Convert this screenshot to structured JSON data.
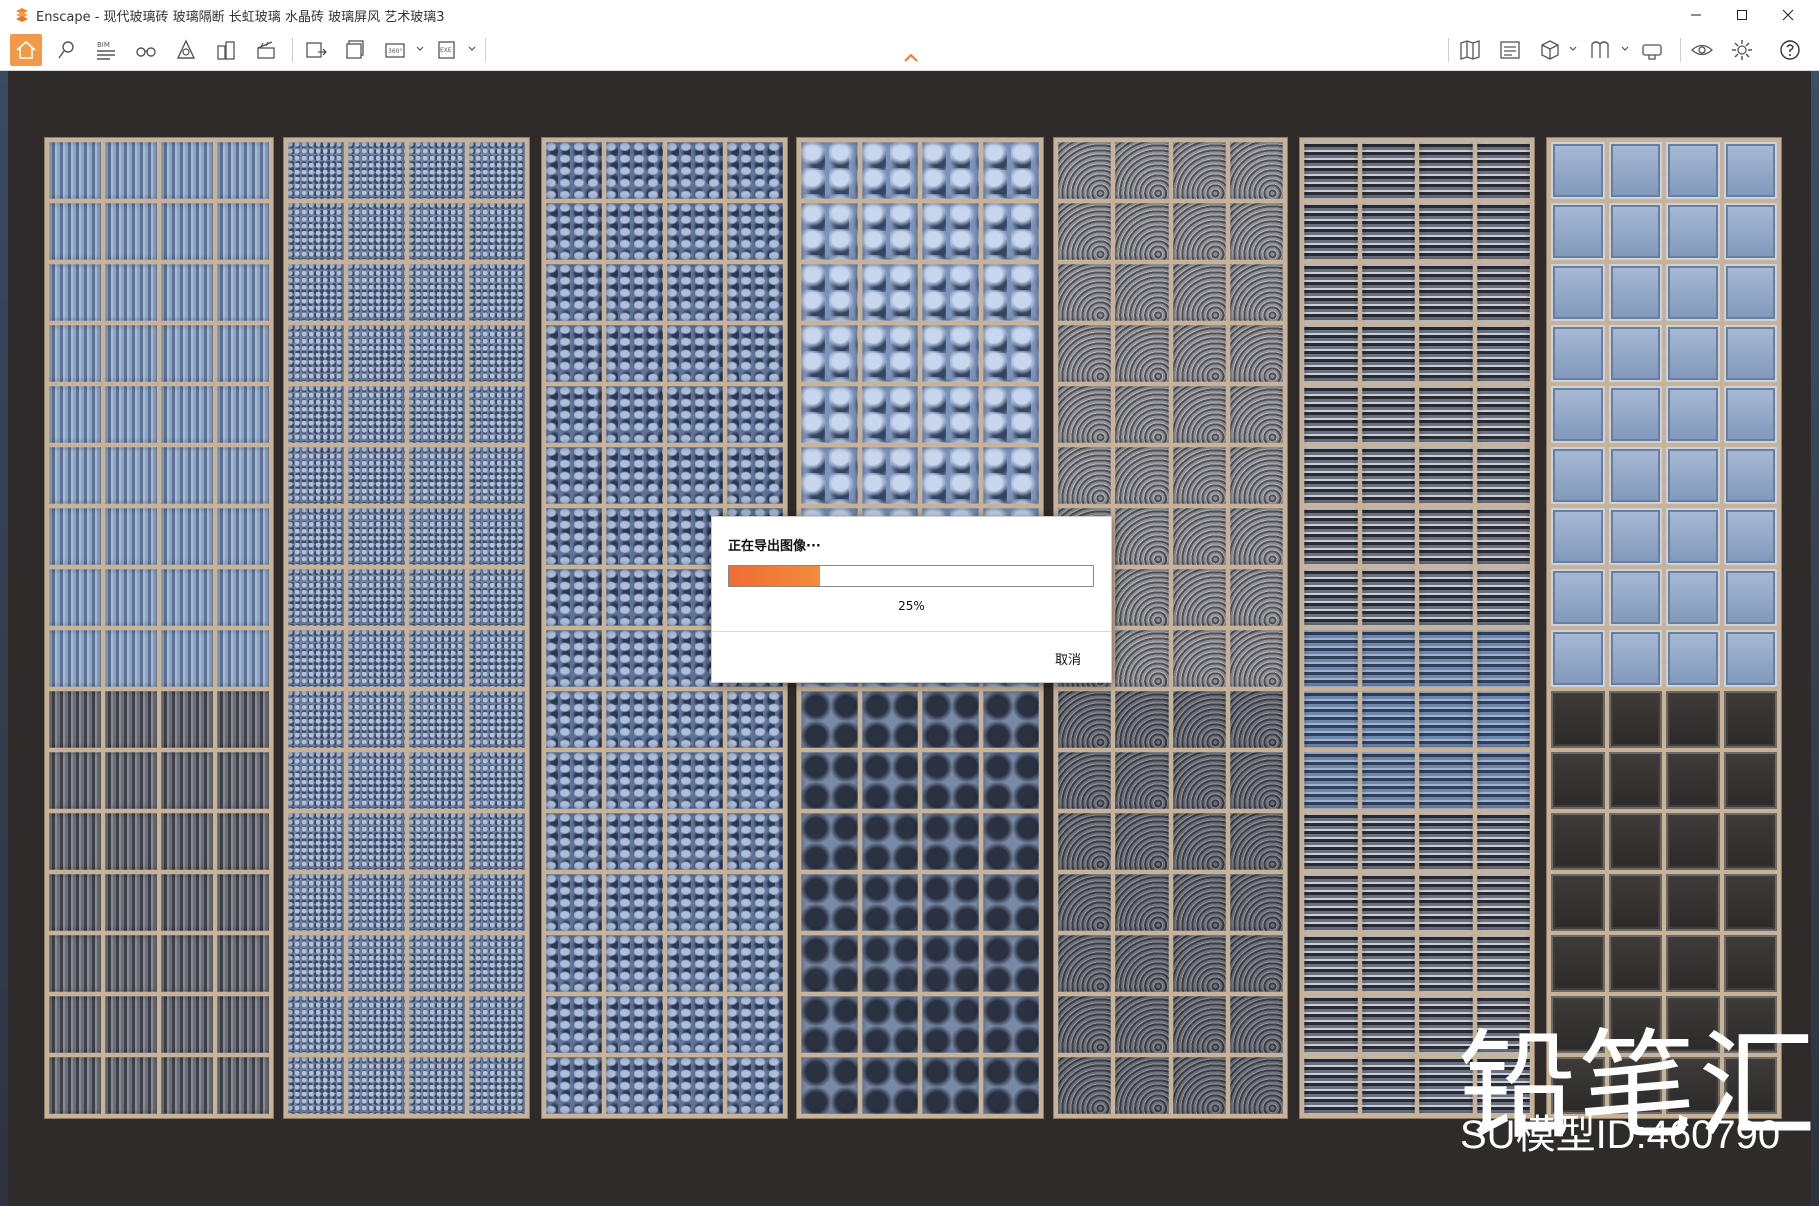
{
  "window": {
    "title": "Enscape - 现代玻璃砖 玻璃隔断 长虹玻璃 水晶砖 玻璃屏风 艺术玻璃3",
    "minimize_icon": "minimize-icon",
    "maximize_icon": "maximize-icon",
    "close_icon": "close-icon"
  },
  "toolbar": {
    "left_tools": [
      {
        "name": "home",
        "icon": "home-icon"
      },
      {
        "name": "pin",
        "icon": "location-pin-icon"
      },
      {
        "name": "bim",
        "icon": "bim-icon",
        "label": "BIM"
      },
      {
        "name": "views",
        "icon": "binoculars-icon"
      },
      {
        "name": "atmosphere",
        "icon": "atmosphere-icon"
      },
      {
        "name": "assets",
        "icon": "buildings-icon"
      },
      {
        "name": "video",
        "icon": "clapperboard-icon"
      },
      {
        "name": "screenshot",
        "icon": "export-image-icon"
      },
      {
        "name": "batch",
        "icon": "batch-render-icon"
      },
      {
        "name": "panorama",
        "icon": "panorama-icon",
        "label": "360°"
      },
      {
        "name": "exe",
        "icon": "exe-export-icon",
        "label": "EXE"
      }
    ],
    "right_tools": [
      {
        "name": "map",
        "icon": "map-icon"
      },
      {
        "name": "sheet",
        "icon": "sheet-icon"
      },
      {
        "name": "cube",
        "icon": "cube-icon"
      },
      {
        "name": "mirror",
        "icon": "mirror-icon"
      },
      {
        "name": "vr",
        "icon": "vr-headset-icon"
      },
      {
        "name": "visibility",
        "icon": "eye-icon"
      },
      {
        "name": "settings",
        "icon": "gear-icon"
      },
      {
        "name": "help",
        "icon": "help-icon"
      }
    ]
  },
  "dialog": {
    "title": "正在导出图像···",
    "progress_percent": 25,
    "progress_text": "25%",
    "cancel_label": "取消"
  },
  "watermark": {
    "brand": "铅笔汇",
    "model_id": "SU模型ID:460790"
  }
}
